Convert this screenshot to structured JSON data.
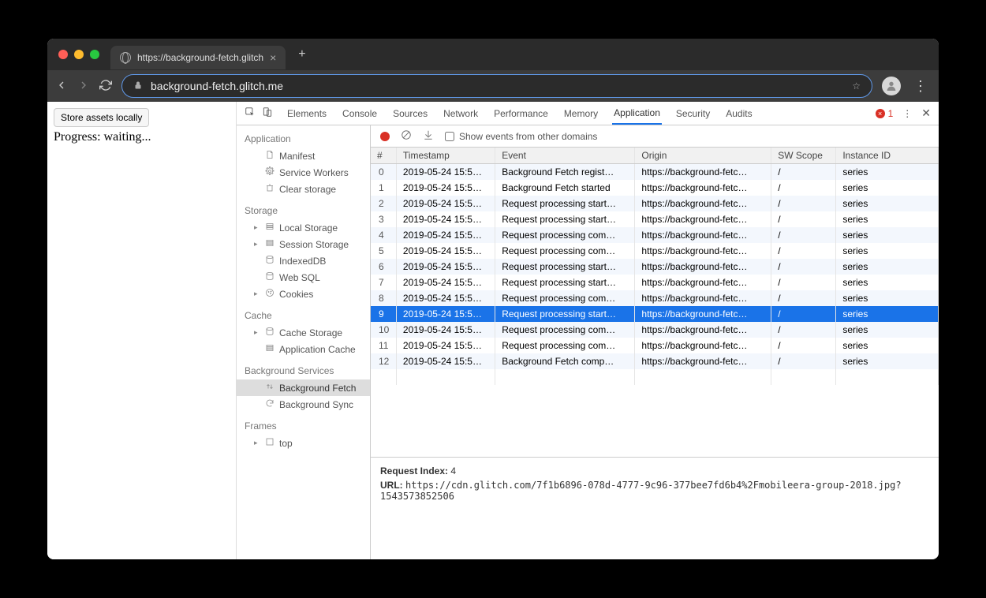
{
  "browser": {
    "tab_title": "https://background-fetch.glitch",
    "url_display": "background-fetch.glitch.me"
  },
  "page": {
    "button": "Store assets locally",
    "progress": "Progress: waiting..."
  },
  "devtools": {
    "tabs": [
      "Elements",
      "Console",
      "Sources",
      "Network",
      "Performance",
      "Memory",
      "Application",
      "Security",
      "Audits"
    ],
    "active_tab": "Application",
    "error_count": "1",
    "appnav": {
      "application_h": "Application",
      "application": [
        "Manifest",
        "Service Workers",
        "Clear storage"
      ],
      "storage_h": "Storage",
      "storage": [
        "Local Storage",
        "Session Storage",
        "IndexedDB",
        "Web SQL",
        "Cookies"
      ],
      "cache_h": "Cache",
      "cache": [
        "Cache Storage",
        "Application Cache"
      ],
      "bg_h": "Background Services",
      "bg": [
        "Background Fetch",
        "Background Sync"
      ],
      "frames_h": "Frames",
      "frames": [
        "top"
      ],
      "selected": "Background Fetch"
    },
    "show_other": "Show events from other domains",
    "columns": [
      "#",
      "Timestamp",
      "Event",
      "Origin",
      "SW Scope",
      "Instance ID"
    ],
    "rows": [
      {
        "n": "0",
        "ts": "2019-05-24 15:5…",
        "ev": "Background Fetch regist…",
        "or": "https://background-fetc…",
        "sw": "/",
        "id": "series"
      },
      {
        "n": "1",
        "ts": "2019-05-24 15:5…",
        "ev": "Background Fetch started",
        "or": "https://background-fetc…",
        "sw": "/",
        "id": "series"
      },
      {
        "n": "2",
        "ts": "2019-05-24 15:5…",
        "ev": "Request processing start…",
        "or": "https://background-fetc…",
        "sw": "/",
        "id": "series"
      },
      {
        "n": "3",
        "ts": "2019-05-24 15:5…",
        "ev": "Request processing start…",
        "or": "https://background-fetc…",
        "sw": "/",
        "id": "series"
      },
      {
        "n": "4",
        "ts": "2019-05-24 15:5…",
        "ev": "Request processing com…",
        "or": "https://background-fetc…",
        "sw": "/",
        "id": "series"
      },
      {
        "n": "5",
        "ts": "2019-05-24 15:5…",
        "ev": "Request processing com…",
        "or": "https://background-fetc…",
        "sw": "/",
        "id": "series"
      },
      {
        "n": "6",
        "ts": "2019-05-24 15:5…",
        "ev": "Request processing start…",
        "or": "https://background-fetc…",
        "sw": "/",
        "id": "series"
      },
      {
        "n": "7",
        "ts": "2019-05-24 15:5…",
        "ev": "Request processing start…",
        "or": "https://background-fetc…",
        "sw": "/",
        "id": "series"
      },
      {
        "n": "8",
        "ts": "2019-05-24 15:5…",
        "ev": "Request processing com…",
        "or": "https://background-fetc…",
        "sw": "/",
        "id": "series"
      },
      {
        "n": "9",
        "ts": "2019-05-24 15:5…",
        "ev": "Request processing start…",
        "or": "https://background-fetc…",
        "sw": "/",
        "id": "series",
        "selected": true
      },
      {
        "n": "10",
        "ts": "2019-05-24 15:5…",
        "ev": "Request processing com…",
        "or": "https://background-fetc…",
        "sw": "/",
        "id": "series"
      },
      {
        "n": "11",
        "ts": "2019-05-24 15:5…",
        "ev": "Request processing com…",
        "or": "https://background-fetc…",
        "sw": "/",
        "id": "series"
      },
      {
        "n": "12",
        "ts": "2019-05-24 15:5…",
        "ev": "Background Fetch comp…",
        "or": "https://background-fetc…",
        "sw": "/",
        "id": "series"
      }
    ],
    "detail": {
      "request_index_label": "Request Index:",
      "request_index_value": "4",
      "url_label": "URL:",
      "url_value": "https://cdn.glitch.com/7f1b6896-078d-4777-9c96-377bee7fd6b4%2Fmobileera-group-2018.jpg?1543573852506"
    }
  }
}
